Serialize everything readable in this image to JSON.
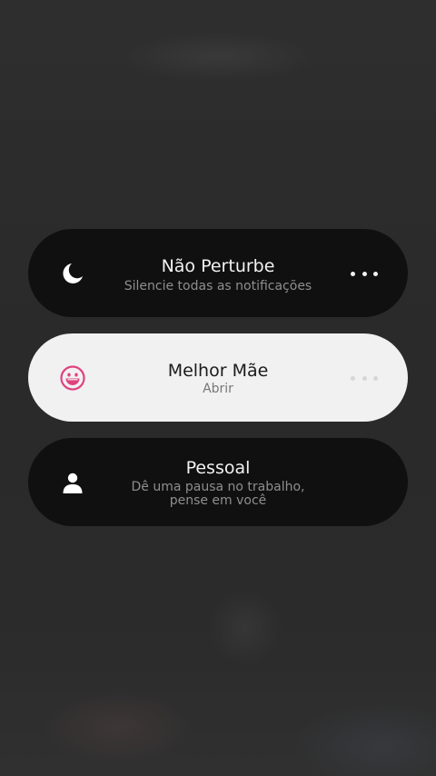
{
  "modes": [
    {
      "title": "Não Perturbe",
      "subtitle": "Silencie todas as notificações",
      "icon": "moon-icon"
    },
    {
      "title": "Melhor Mãe",
      "subtitle": "Abrir",
      "icon": "smiley-face-icon",
      "accent": "#e0427e"
    },
    {
      "title": "Pessoal",
      "subtitle_line1": "Dê uma pausa no trabalho,",
      "subtitle_line2": "pense em você",
      "icon": "person-icon"
    }
  ]
}
